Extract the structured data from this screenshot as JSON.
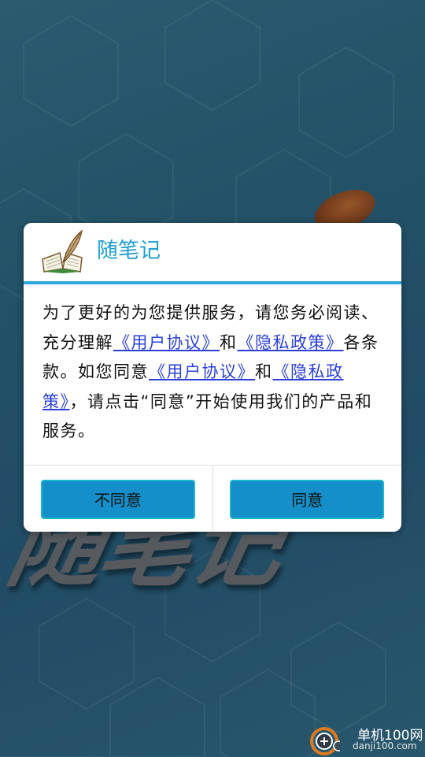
{
  "background": {
    "logo_text": "随笔记"
  },
  "dialog": {
    "title": "随笔记",
    "body": {
      "p1": "为了更好的为您提供服务，请您务必阅读、充分理解",
      "link1": "《用户协议》",
      "p2": "和",
      "link2": "《隐私政策》",
      "p3": "各条款。如您同意",
      "link3": "《用户协议》",
      "p4": "和",
      "link4": "《隐私政策》",
      "p5": "，请点击“同意”开始使用我们的产品和服务。"
    },
    "buttons": {
      "disagree": "不同意",
      "agree": "同意"
    }
  },
  "watermark": {
    "line1": "单机100网",
    "line2": "danji100.com"
  },
  "colors": {
    "accent": "#1fa0d2",
    "button_fill": "#148fc9",
    "link": "#2a3fd8"
  }
}
